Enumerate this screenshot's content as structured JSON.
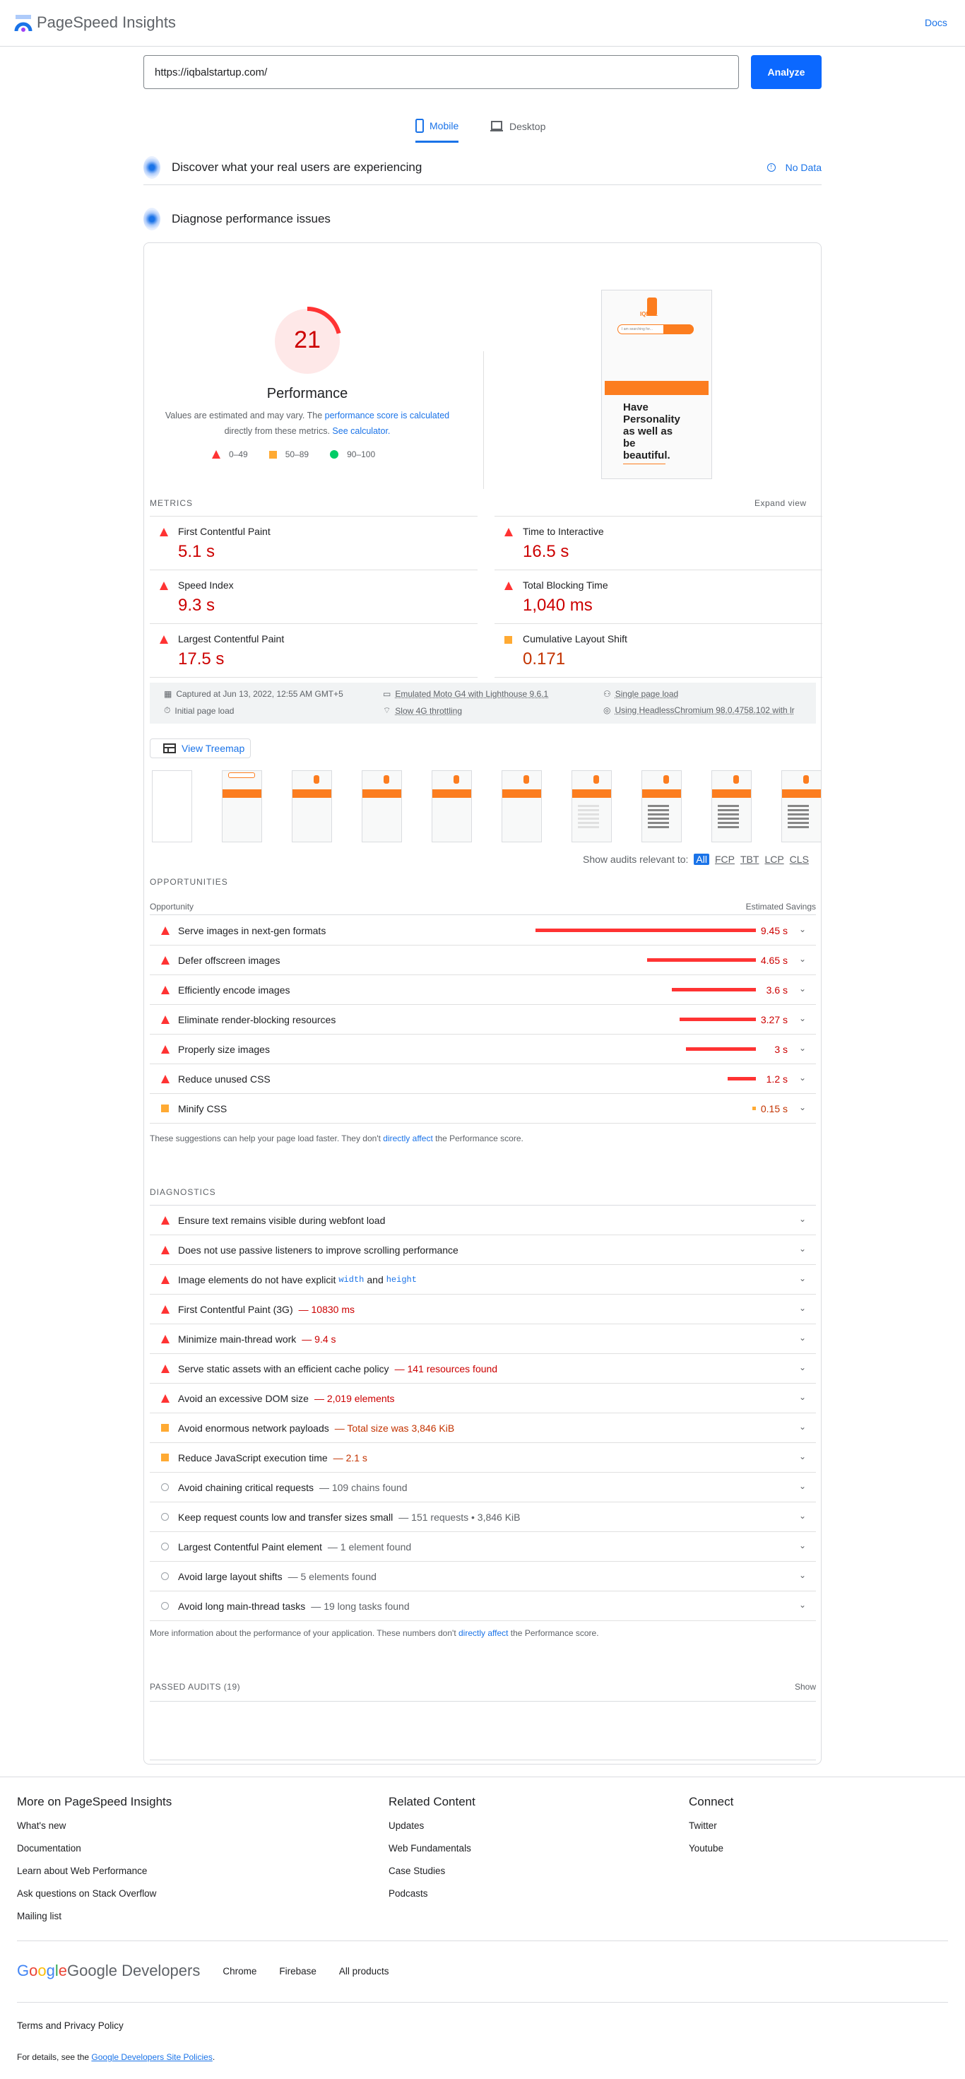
{
  "header": {
    "title": "PageSpeed Insights",
    "docs": "Docs"
  },
  "search": {
    "url": "https://iqbalstartup.com/",
    "analyze": "Analyze"
  },
  "tabs": {
    "mobile": "Mobile",
    "desktop": "Desktop",
    "active": "mobile"
  },
  "field": {
    "title": "Discover what your real users are experiencing",
    "status": "No Data"
  },
  "lab": {
    "title": "Diagnose performance issues"
  },
  "performance": {
    "score": 21,
    "label": "Performance",
    "note_prefix": "Values are estimated and may vary. The ",
    "note_link": "performance score is calculated",
    "note_mid": " directly from these metrics. ",
    "note_link2": "See calculator.",
    "legend": [
      "0–49",
      "50–89",
      "90–100"
    ],
    "colors": {
      "fail": "#ff3333",
      "average": "#ffaa33",
      "pass": "#00cc66"
    }
  },
  "screenshot": {
    "search_placeholder": "I am searching for...",
    "logo": "IQBAL",
    "headline": "Have Personality as well as be beautiful."
  },
  "metrics": {
    "title": "METRICS",
    "expand": "Expand view",
    "items": [
      {
        "label": "First Contentful Paint",
        "value": "5.1 s",
        "rating": "fail"
      },
      {
        "label": "Time to Interactive",
        "value": "16.5 s",
        "rating": "fail"
      },
      {
        "label": "Speed Index",
        "value": "9.3 s",
        "rating": "fail"
      },
      {
        "label": "Total Blocking Time",
        "value": "1,040 ms",
        "rating": "fail"
      },
      {
        "label": "Largest Contentful Paint",
        "value": "17.5 s",
        "rating": "fail"
      },
      {
        "label": "Cumulative Layout Shift",
        "value": "0.171",
        "rating": "average"
      }
    ]
  },
  "run_info": {
    "captured": "Captured at Jun 13, 2022, 12:55 AM GMT+5",
    "device": "Emulated Moto G4 with Lighthouse 9.6.1",
    "session": "Single page load",
    "load": "Initial page load",
    "throttling": "Slow 4G throttling",
    "browser": "Using HeadlessChromium 98.0.4758.102 with lr"
  },
  "treemap": "View Treemap",
  "filter": {
    "label": "Show audits relevant to:",
    "options": [
      "All",
      "FCP",
      "TBT",
      "LCP",
      "CLS"
    ],
    "active": "All"
  },
  "opportunities": {
    "title": "OPPORTUNITIES",
    "col1": "Opportunity",
    "col2": "Estimated Savings",
    "items": [
      {
        "label": "Serve images in next-gen formats",
        "savings": "9.45 s",
        "seconds": 9.45,
        "rating": "fail"
      },
      {
        "label": "Defer offscreen images",
        "savings": "4.65 s",
        "seconds": 4.65,
        "rating": "fail"
      },
      {
        "label": "Efficiently encode images",
        "savings": "3.6 s",
        "seconds": 3.6,
        "rating": "fail"
      },
      {
        "label": "Eliminate render-blocking resources",
        "savings": "3.27 s",
        "seconds": 3.27,
        "rating": "fail"
      },
      {
        "label": "Properly size images",
        "savings": "3 s",
        "seconds": 3,
        "rating": "fail"
      },
      {
        "label": "Reduce unused CSS",
        "savings": "1.2 s",
        "seconds": 1.2,
        "rating": "fail"
      },
      {
        "label": "Minify CSS",
        "savings": "0.15 s",
        "seconds": 0.15,
        "rating": "average"
      }
    ],
    "note_prefix": "These suggestions can help your page load faster. They don't ",
    "note_link": "directly affect",
    "note_suffix": " the Performance score."
  },
  "diagnostics": {
    "title": "DIAGNOSTICS",
    "items": [
      {
        "label": "Ensure text remains visible during webfont load",
        "detail": "",
        "rating": "fail"
      },
      {
        "label": "Does not use passive listeners to improve scrolling performance",
        "detail": "",
        "rating": "fail"
      },
      {
        "label": "Image elements do not have explicit",
        "code1": "width",
        "and": "and",
        "code2": "height",
        "detail": "",
        "rating": "fail"
      },
      {
        "label": "First Contentful Paint (3G)",
        "detail": "10830 ms",
        "rating": "fail"
      },
      {
        "label": "Minimize main-thread work",
        "detail": "9.4 s",
        "rating": "fail"
      },
      {
        "label": "Serve static assets with an efficient cache policy",
        "detail": "141 resources found",
        "rating": "fail"
      },
      {
        "label": "Avoid an excessive DOM size",
        "detail": "2,019 elements",
        "rating": "fail"
      },
      {
        "label": "Avoid enormous network payloads",
        "detail": "Total size was 3,846 KiB",
        "rating": "average"
      },
      {
        "label": "Reduce JavaScript execution time",
        "detail": "2.1 s",
        "rating": "average"
      },
      {
        "label": "Avoid chaining critical requests",
        "detail": "109 chains found",
        "rating": "info"
      },
      {
        "label": "Keep request counts low and transfer sizes small",
        "detail": "151 requests • 3,846 KiB",
        "rating": "info"
      },
      {
        "label": "Largest Contentful Paint element",
        "detail": "1 element found",
        "rating": "info"
      },
      {
        "label": "Avoid large layout shifts",
        "detail": "5 elements found",
        "rating": "info"
      },
      {
        "label": "Avoid long main-thread tasks",
        "detail": "19 long tasks found",
        "rating": "info"
      }
    ],
    "note_prefix": "More information about the performance of your application. These numbers don't ",
    "note_link": "directly affect",
    "note_suffix": " the Performance score."
  },
  "passed": {
    "title": "PASSED AUDITS (19)",
    "show": "Show"
  },
  "footer": {
    "columns": [
      {
        "heading": "More on PageSpeed Insights",
        "links": [
          "What's new",
          "Documentation",
          "Learn about Web Performance",
          "Ask questions on Stack Overflow",
          "Mailing list"
        ]
      },
      {
        "heading": "Related Content",
        "links": [
          "Updates",
          "Web Fundamentals",
          "Case Studies",
          "Podcasts"
        ]
      },
      {
        "heading": "Connect",
        "links": [
          "Twitter",
          "Youtube"
        ]
      }
    ],
    "brand": "Google Developers",
    "products": [
      "Chrome",
      "Firebase",
      "All products"
    ],
    "terms": "Terms and Privacy Policy",
    "details_prefix": "For details, see the ",
    "details_link": "Google Developers Site Policies",
    "details_suffix": "."
  }
}
